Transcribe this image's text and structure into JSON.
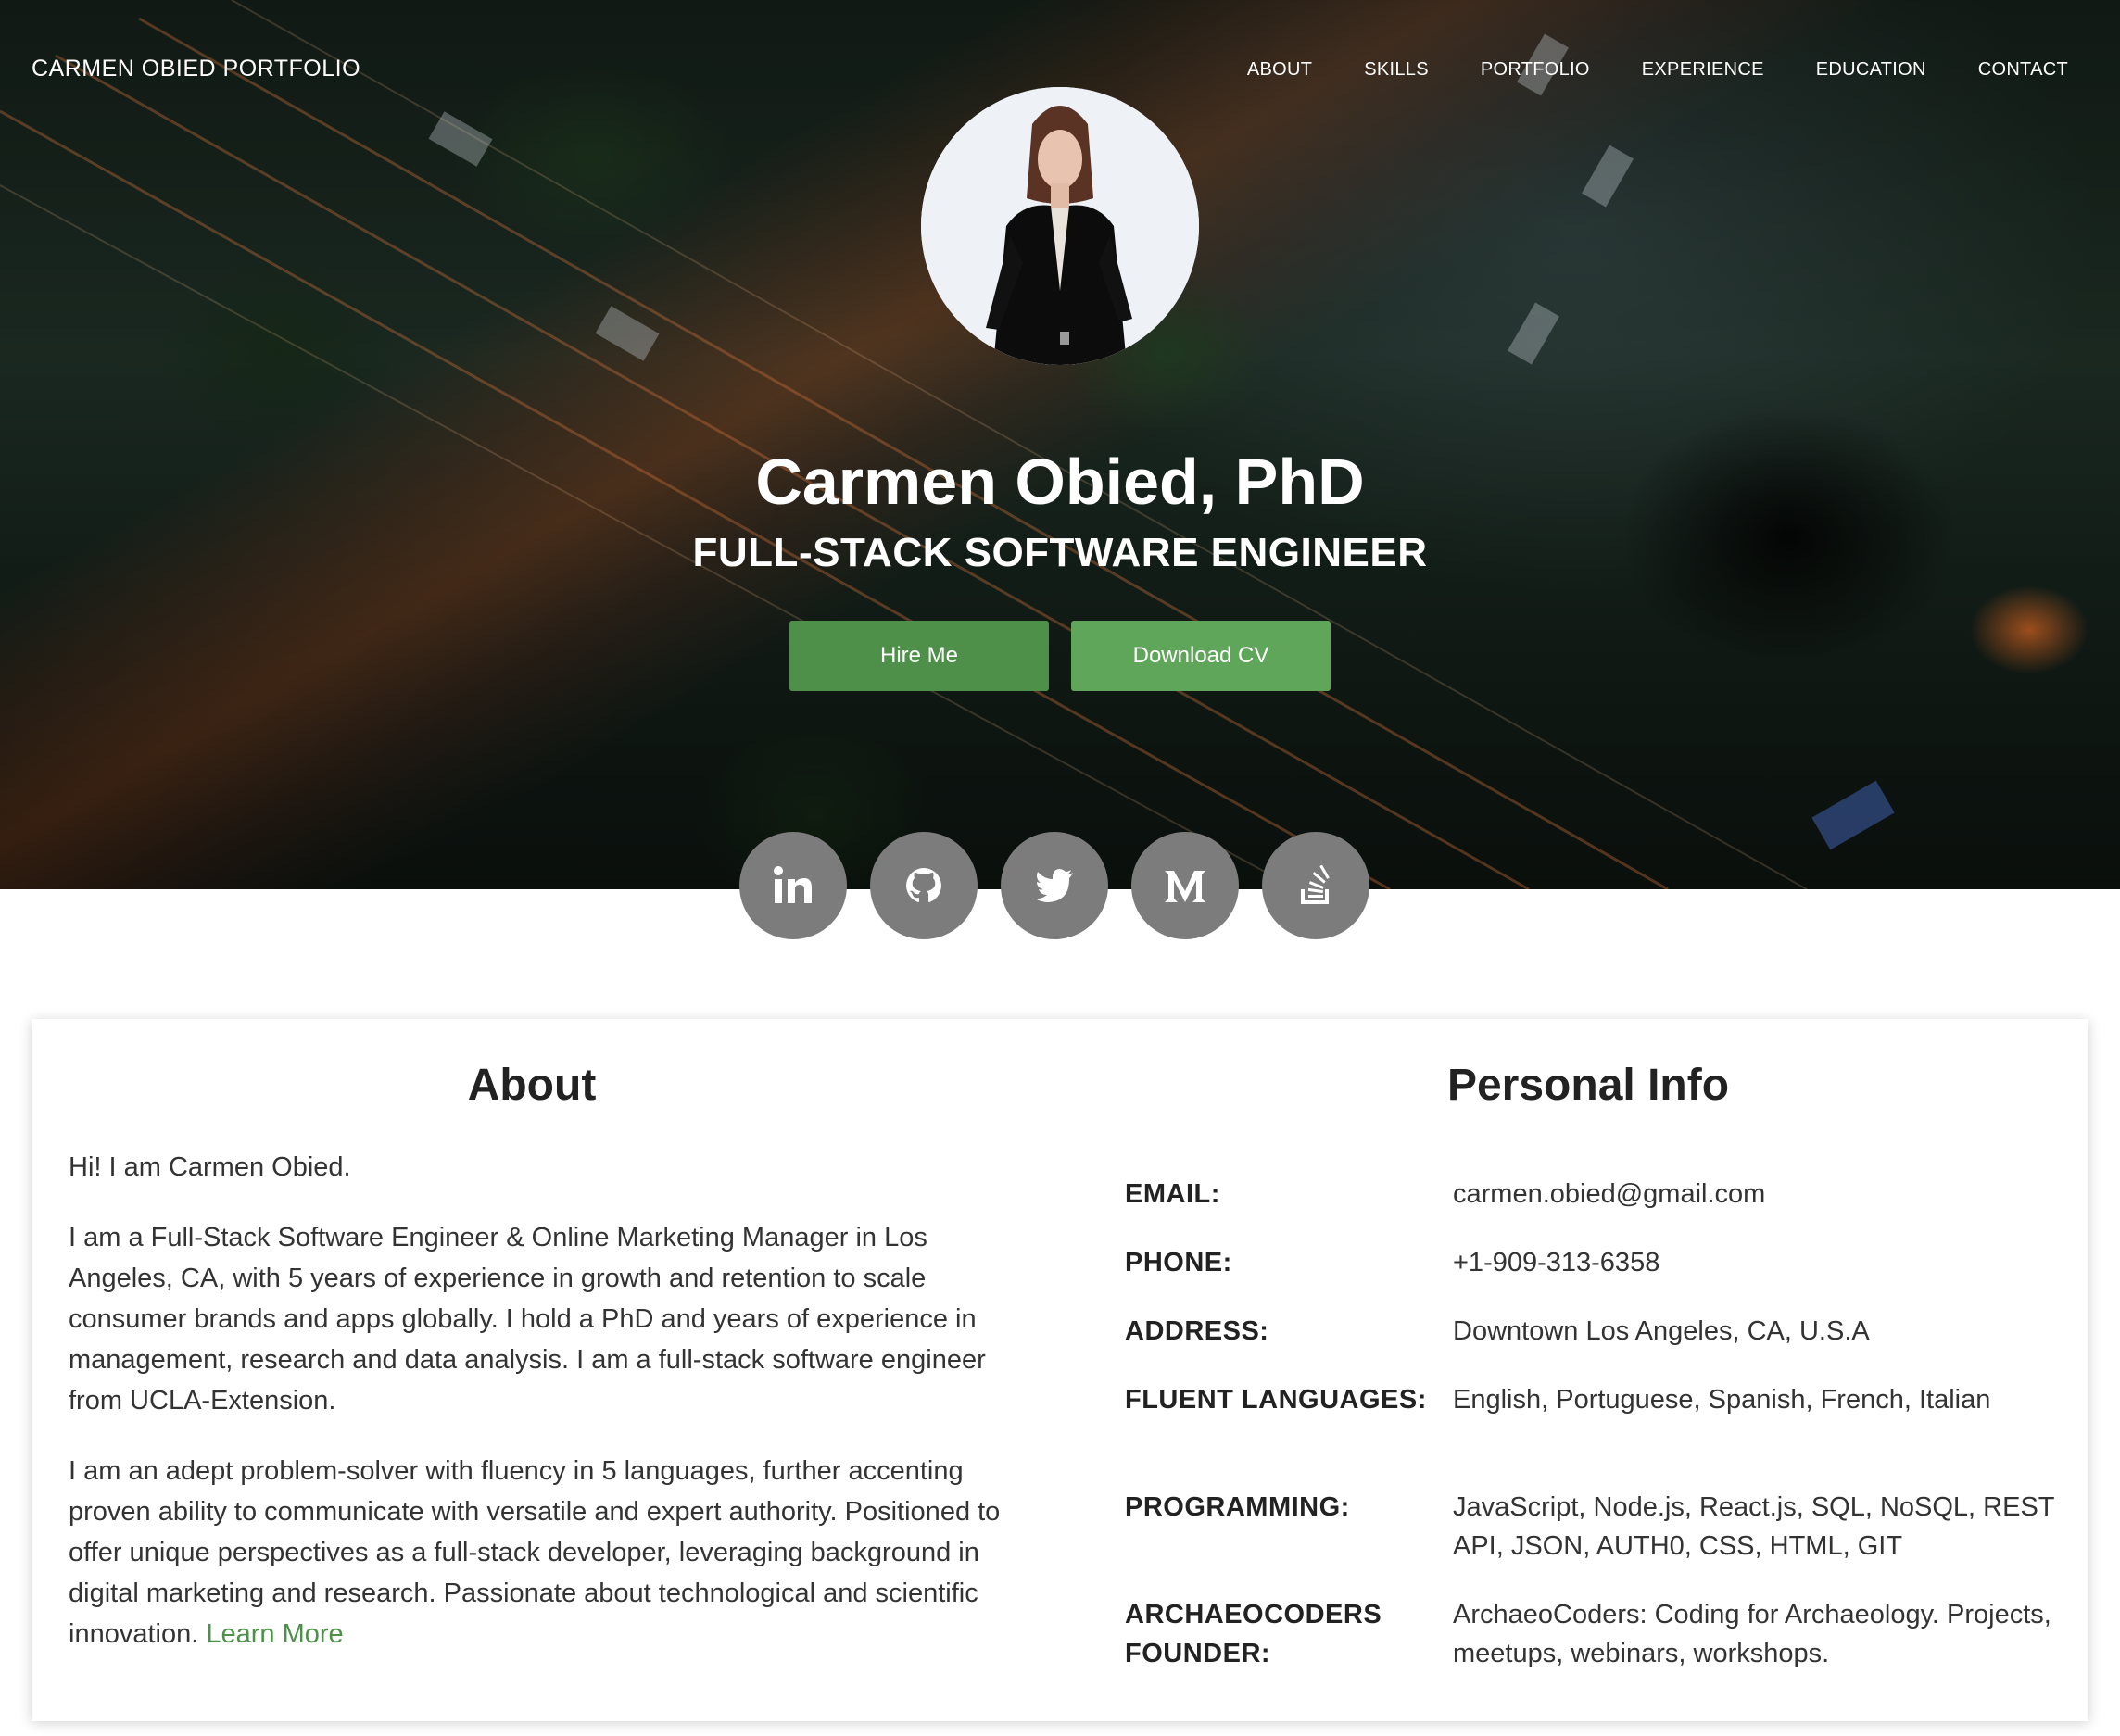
{
  "nav": {
    "brand": "CARMEN OBIED PORTFOLIO",
    "items": [
      {
        "label": "ABOUT"
      },
      {
        "label": "SKILLS"
      },
      {
        "label": "PORTFOLIO"
      },
      {
        "label": "EXPERIENCE"
      },
      {
        "label": "EDUCATION"
      },
      {
        "label": "CONTACT"
      }
    ]
  },
  "hero": {
    "name": "Carmen Obied, PhD",
    "subtitle": "FULL-STACK SOFTWARE ENGINEER",
    "hire_label": "Hire Me",
    "cv_label": "Download CV"
  },
  "socials": [
    {
      "icon": "linkedin-icon"
    },
    {
      "icon": "github-icon"
    },
    {
      "icon": "twitter-icon"
    },
    {
      "icon": "medium-icon"
    },
    {
      "icon": "stackoverflow-icon"
    }
  ],
  "about": {
    "title": "About",
    "p1": "Hi! I am Carmen Obied.",
    "p2": "I am a Full-Stack Software Engineer & Online Marketing Manager in Los Angeles, CA, with 5 years of experience in growth and retention to scale consumer brands and apps globally. I hold a PhD and years of experience in management, research and data analysis. I am a full-stack software engineer from UCLA-Extension.",
    "p3": "I am an adept problem-solver with fluency in 5 languages, further accenting proven ability to communicate with versatile and expert authority. Positioned to offer unique perspectives as a full-stack developer, leveraging background in digital marketing and research. Passionate about technological and scientific innovation.",
    "learn_more": "Learn More"
  },
  "info": {
    "title": "Personal Info",
    "rows": [
      {
        "label": "EMAIL:",
        "value": "carmen.obied@gmail.com"
      },
      {
        "label": "PHONE:",
        "value": "+1-909-313-6358"
      },
      {
        "label": "ADDRESS:",
        "value": "Downtown Los Angeles, CA, U.S.A"
      },
      {
        "label": "FLUENT LANGUAGES:",
        "value": "English, Portuguese, Spanish, French, Italian"
      },
      {
        "label": "PROGRAMMING:",
        "value": "JavaScript, Node.js, React.js, SQL, NoSQL, REST API, JSON, AUTH0, CSS, HTML, GIT"
      },
      {
        "label": "ARCHAEOCODERS FOUNDER:",
        "value": "ArchaeoCoders: Coding for Archaeology. Projects, meetups, webinars, workshops."
      }
    ]
  },
  "colors": {
    "accent": "#5a9c54",
    "social_bg": "#7c7c7c"
  }
}
